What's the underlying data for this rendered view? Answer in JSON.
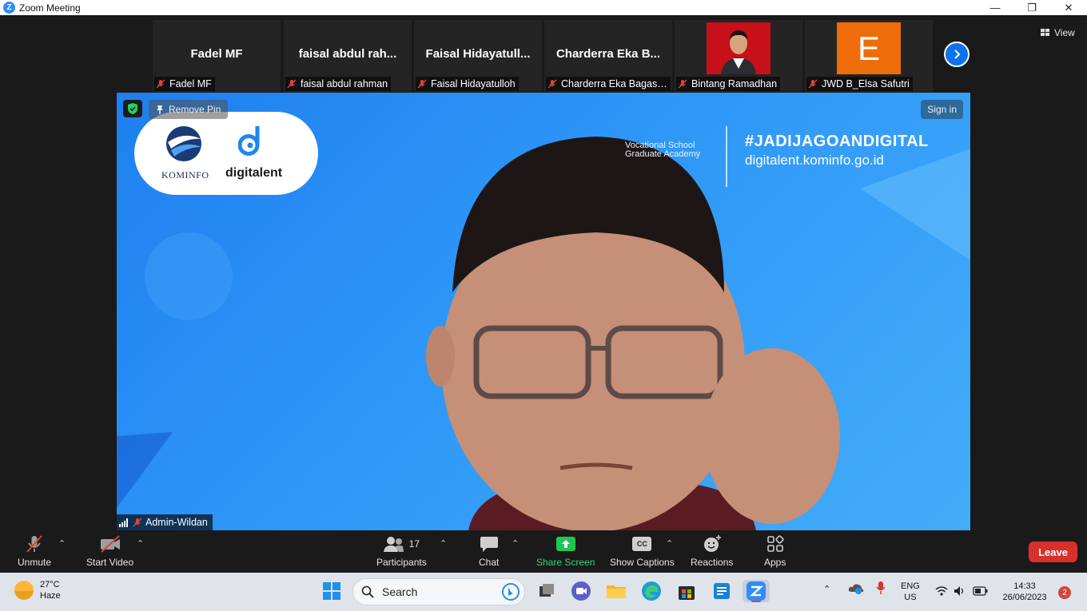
{
  "window": {
    "title": "Zoom Meeting",
    "minimize": "—",
    "maximize": "❐",
    "close": "✕"
  },
  "gallery": {
    "tiles": [
      {
        "display_name": "Fadel MF",
        "label": "Fadel MF",
        "muted": true
      },
      {
        "display_name": "faisal abdul rah...",
        "label": "faisal abdul rahman",
        "muted": true
      },
      {
        "display_name": "Faisal Hidayatull...",
        "label": "Faisal Hidayatulloh",
        "muted": true
      },
      {
        "display_name": "Charderra Eka B...",
        "label": "Charderra Eka Bagas ...",
        "muted": true
      },
      {
        "display_name": "",
        "label": "Bintang Ramadhan",
        "muted": true
      },
      {
        "display_name": "E",
        "label": "JWD B_Elsa Safutri",
        "muted": true,
        "avatar_color": "#ef6c0b"
      }
    ],
    "view_label": "View"
  },
  "main_video": {
    "remove_pin_label": "Remove Pin",
    "sign_in_label": "Sign in",
    "logo_left": "KOMINFO",
    "logo_right": "digitalent",
    "banner_lines": [
      "Vocational School",
      "Graduate Academy"
    ],
    "hashtag": "#JADIJAGOANDIGITAL",
    "website": "digitalent.kominfo.go.id",
    "speaker_name": "Admin-Wildan"
  },
  "toolbar": {
    "unmute": "Unmute",
    "start_video": "Start Video",
    "participants": "Participants",
    "participants_count": "17",
    "chat": "Chat",
    "share_screen": "Share Screen",
    "show_captions": "Show Captions",
    "captions_badge": "CC",
    "reactions": "Reactions",
    "apps": "Apps",
    "leave": "Leave",
    "share_color": "#3ad16d",
    "leave_color": "#d9302c"
  },
  "taskbar": {
    "temperature": "27°C",
    "weather": "Haze",
    "search_placeholder": "Search",
    "lang_top": "ENG",
    "lang_bottom": "US",
    "time": "14:33",
    "date": "26/06/2023",
    "notification_count": "2"
  }
}
